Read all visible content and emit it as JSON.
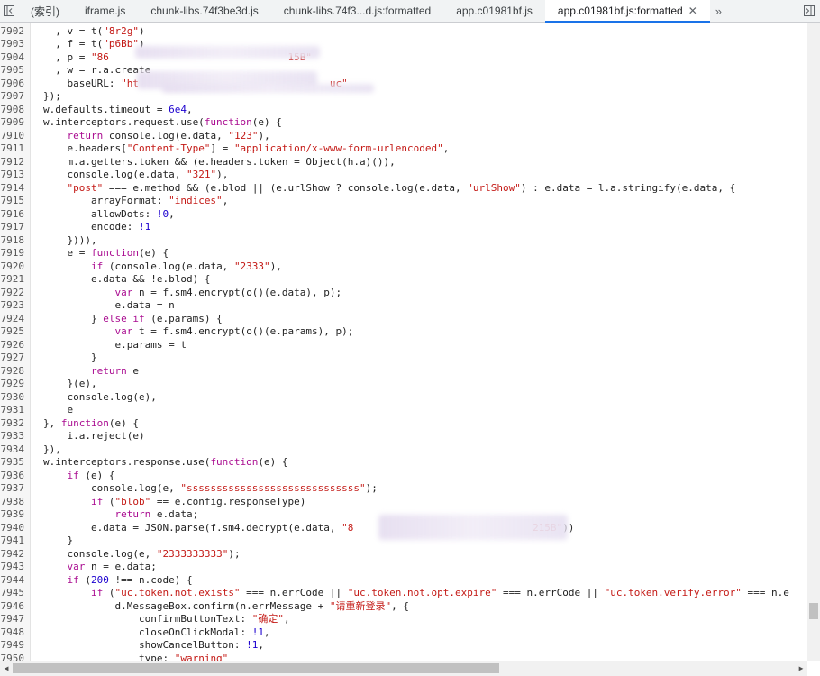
{
  "tabs": [
    {
      "label": "(索引)",
      "active": false
    },
    {
      "label": "iframe.js",
      "active": false
    },
    {
      "label": "chunk-libs.74f3be3d.js",
      "active": false
    },
    {
      "label": "chunk-libs.74f3...d.js:formatted",
      "active": false
    },
    {
      "label": "app.c01981bf.js",
      "active": false
    },
    {
      "label": "app.c01981bf.js:formatted",
      "active": true
    }
  ],
  "icons": {
    "navigator": "sidebar-toggle-icon",
    "close": "close-icon",
    "more": "double-chevron-right-icon",
    "right_toggle": "sidebar-toggle-right-icon"
  },
  "editor": {
    "lines": [
      {
        "n": "7902",
        "t": "    , v = t(\"8r2g\")"
      },
      {
        "n": "7903",
        "t": "    , f = t(\"p6Bb\")"
      },
      {
        "n": "7904",
        "t": "    , p = \"86                              15B\""
      },
      {
        "n": "7905",
        "t": "    , w = r.a.create"
      },
      {
        "n": "7906",
        "t": "      baseURL: \"ht                                uc\""
      },
      {
        "n": "7907",
        "t": "  });"
      },
      {
        "n": "7908",
        "t": "  w.defaults.timeout = 6e4,"
      },
      {
        "n": "7909",
        "t": "  w.interceptors.request.use(function(e) {"
      },
      {
        "n": "7910",
        "t": "      return console.log(e.data, \"123\"),"
      },
      {
        "n": "7911",
        "t": "      e.headers[\"Content-Type\"] = \"application/x-www-form-urlencoded\","
      },
      {
        "n": "7912",
        "t": "      m.a.getters.token && (e.headers.token = Object(h.a)()),"
      },
      {
        "n": "7913",
        "t": "      console.log(e.data, \"321\"),"
      },
      {
        "n": "7914",
        "t": "      \"post\" === e.method && (e.blod || (e.urlShow ? console.log(e.data, \"urlShow\") : e.data = l.a.stringify(e.data, {"
      },
      {
        "n": "7915",
        "t": "          arrayFormat: \"indices\","
      },
      {
        "n": "7916",
        "t": "          allowDots: !0,"
      },
      {
        "n": "7917",
        "t": "          encode: !1"
      },
      {
        "n": "7918",
        "t": "      }))),"
      },
      {
        "n": "7919",
        "t": "      e = function(e) {"
      },
      {
        "n": "7920",
        "t": "          if (console.log(e.data, \"2333\"),"
      },
      {
        "n": "7921",
        "t": "          e.data && !e.blod) {"
      },
      {
        "n": "7922",
        "t": "              var n = f.sm4.encrypt(o()(e.data), p);"
      },
      {
        "n": "7923",
        "t": "              e.data = n"
      },
      {
        "n": "7924",
        "t": "          } else if (e.params) {"
      },
      {
        "n": "7925",
        "t": "              var t = f.sm4.encrypt(o()(e.params), p);"
      },
      {
        "n": "7926",
        "t": "              e.params = t"
      },
      {
        "n": "7927",
        "t": "          }"
      },
      {
        "n": "7928",
        "t": "          return e"
      },
      {
        "n": "7929",
        "t": "      }(e),"
      },
      {
        "n": "7930",
        "t": "      console.log(e),"
      },
      {
        "n": "7931",
        "t": "      e"
      },
      {
        "n": "7932",
        "t": "  }, function(e) {"
      },
      {
        "n": "7933",
        "t": "      i.a.reject(e)"
      },
      {
        "n": "7934",
        "t": "  }),"
      },
      {
        "n": "7935",
        "t": "  w.interceptors.response.use(function(e) {"
      },
      {
        "n": "7936",
        "t": "      if (e) {"
      },
      {
        "n": "7937",
        "t": "          console.log(e, \"sssssssssssssssssssssssssssss\");"
      },
      {
        "n": "7938",
        "t": "          if (\"blob\" == e.config.responseType)"
      },
      {
        "n": "7939",
        "t": "              return e.data;"
      },
      {
        "n": "7940",
        "t": "          e.data = JSON.parse(f.sm4.decrypt(e.data, \"8                              215B\"))"
      },
      {
        "n": "7941",
        "t": "      }"
      },
      {
        "n": "7942",
        "t": "      console.log(e, \"2333333333\");"
      },
      {
        "n": "7943",
        "t": "      var n = e.data;"
      },
      {
        "n": "7944",
        "t": "      if (200 !== n.code) {"
      },
      {
        "n": "7945",
        "t": "          if (\"uc.token.not.exists\" === n.errCode || \"uc.token.not.opt.expire\" === n.errCode || \"uc.token.verify.error\" === n.e"
      },
      {
        "n": "7946",
        "t": "              d.MessageBox.confirm(n.errMessage + \"请重新登录\", {"
      },
      {
        "n": "7947",
        "t": "                  confirmButtonText: \"确定\","
      },
      {
        "n": "7948",
        "t": "                  closeOnClickModal: !1,"
      },
      {
        "n": "7949",
        "t": "                  showCancelButton: !1,"
      },
      {
        "n": "7950",
        "t": "                  type: \"warning\""
      }
    ]
  }
}
